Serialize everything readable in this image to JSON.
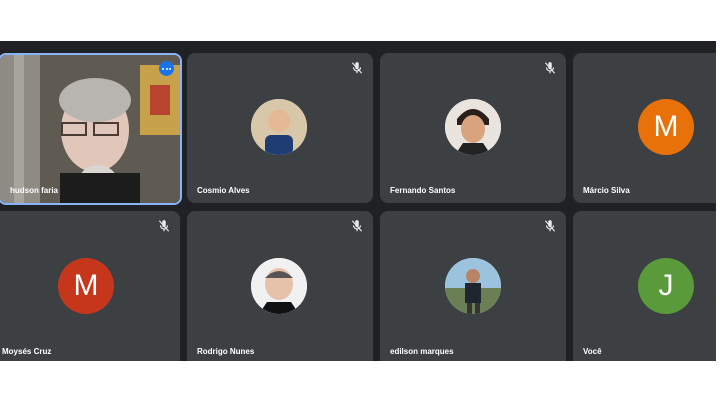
{
  "participants": [
    {
      "name": "hudson faria",
      "active": true
    },
    {
      "name": "Cosmio Alves",
      "muted": true
    },
    {
      "name": "Fernando Santos",
      "muted": true
    },
    {
      "name": "Márcio Silva",
      "initial": "M",
      "color": "#e8710a"
    },
    {
      "name": "Moysés Cruz",
      "initial": "M",
      "color": "#c5361b",
      "muted": true
    },
    {
      "name": "Rodrigo Nunes",
      "muted": true
    },
    {
      "name": "edilson marques",
      "muted": true
    },
    {
      "name": "Você",
      "initial": "J",
      "color": "#5b9a3a"
    }
  ],
  "icons": {
    "mic_off": "mic-off-icon",
    "more": "more-options-icon"
  }
}
